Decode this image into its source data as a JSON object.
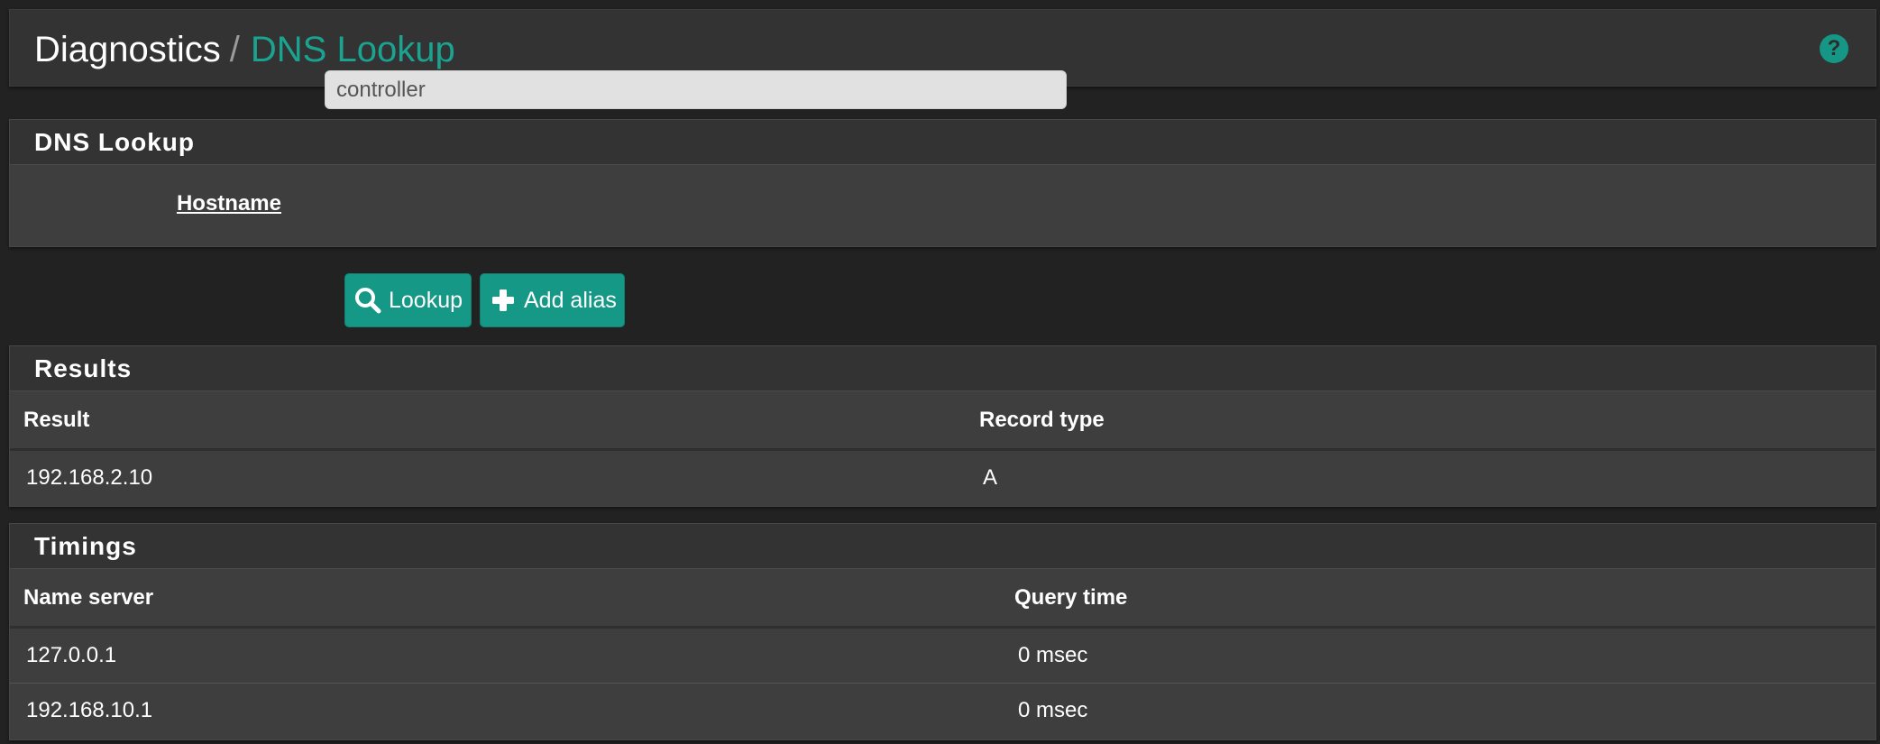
{
  "header": {
    "breadcrumb_root": "Diagnostics",
    "breadcrumb_separator": "/",
    "breadcrumb_current": "DNS Lookup",
    "help_icon": "question-circle-icon",
    "help_glyph": "?"
  },
  "lookup": {
    "title": "DNS Lookup",
    "hostname_label": "Hostname",
    "hostname_value": "controller"
  },
  "buttons": {
    "lookup_label": "Lookup",
    "lookup_icon": "search-icon",
    "add_alias_label": "Add alias",
    "add_alias_icon": "plus-icon"
  },
  "results": {
    "title": "Results",
    "columns": [
      "Result",
      "Record type"
    ],
    "rows": [
      [
        "192.168.2.10",
        "A"
      ]
    ]
  },
  "timings": {
    "title": "Timings",
    "columns": [
      "Name server",
      "Query time"
    ],
    "rows": [
      [
        "127.0.0.1",
        "0 msec"
      ],
      [
        "192.168.10.1",
        "0 msec"
      ]
    ]
  },
  "colors": {
    "accent": "#1aa390",
    "button": "#159886",
    "background": "#222222",
    "panel": "#3e3e3e",
    "panel_heading": "#333333"
  }
}
